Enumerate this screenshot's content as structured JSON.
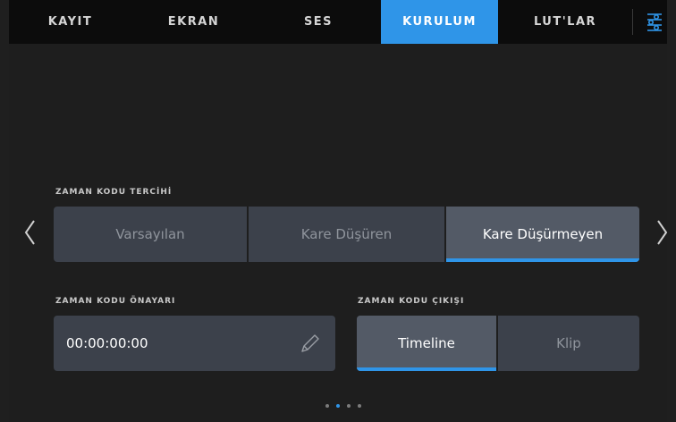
{
  "tabs": [
    {
      "label": "KAYIT",
      "active": false
    },
    {
      "label": "EKRAN",
      "active": false
    },
    {
      "label": "SES",
      "active": false
    },
    {
      "label": "KURULUM",
      "active": true
    },
    {
      "label": "LUT'LAR",
      "active": false
    }
  ],
  "settings_icon": "sliders-icon",
  "timecode_preference": {
    "label": "ZAMAN KODU TERCİHİ",
    "options": [
      "Varsayılan",
      "Kare Düşüren",
      "Kare Düşürmeyen"
    ],
    "selected": "Kare Düşürmeyen"
  },
  "timecode_preset": {
    "label": "ZAMAN KODU ÖNAYARI",
    "value": "00:00:00:00",
    "icon": "pencil-icon"
  },
  "timecode_output": {
    "label": "ZAMAN KODU ÇIKIŞI",
    "options": [
      "Timeline",
      "Klip"
    ],
    "selected": "Timeline"
  },
  "pager": {
    "total": 4,
    "current": 2
  },
  "colors": {
    "accent": "#2f95e8",
    "background": "#1e1e1e",
    "tabbar": "#0c0c0c",
    "control": "#3c414b",
    "control_selected": "#535a66"
  }
}
